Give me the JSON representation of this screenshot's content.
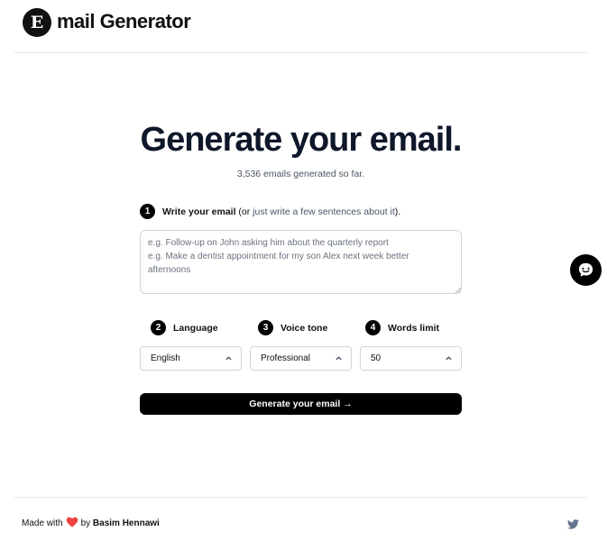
{
  "header": {
    "logo_letter": "E",
    "brand": "mail Generator"
  },
  "hero": {
    "title": "Generate your email.",
    "counter": "3,536 emails generated so far."
  },
  "steps": {
    "step1": {
      "number": "1",
      "label": "Write your email",
      "paren_open": "(or ",
      "link": "just write a few sentences about it",
      "paren_close": ")."
    },
    "step2": {
      "number": "2",
      "label": "Language"
    },
    "step3": {
      "number": "3",
      "label": "Voice tone"
    },
    "step4": {
      "number": "4",
      "label": "Words limit"
    }
  },
  "email_input": {
    "placeholder": "e.g. Follow-up on John asking him about the quarterly report\ne.g. Make a dentist appointment for my son Alex next week better afternoons",
    "value": ""
  },
  "selects": {
    "language": "English",
    "tone": "Professional",
    "words": "50"
  },
  "generate_button": "Generate your email →",
  "footer": {
    "made_with": "Made with",
    "by": "by",
    "author": "Basim Hennawi"
  },
  "colors": {
    "accent": "#000000",
    "link": "#475569",
    "heart": "#ef4444",
    "twitter": "#64748b"
  },
  "icons": [
    "chat-icon",
    "heart-icon",
    "twitter-icon",
    "chevron-up-icon"
  ]
}
